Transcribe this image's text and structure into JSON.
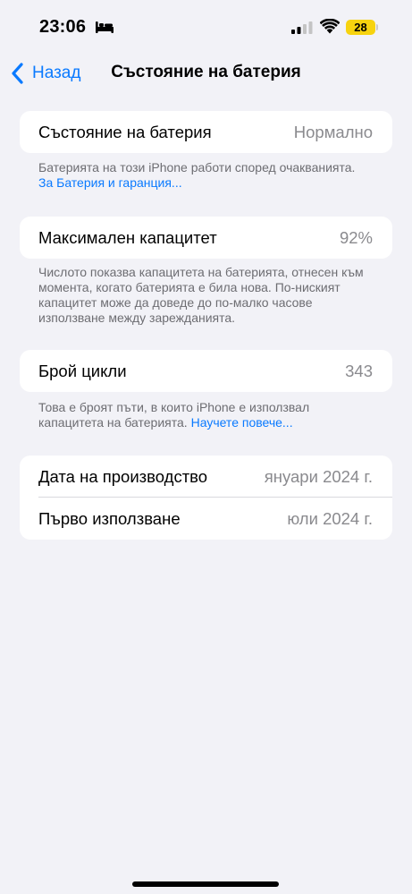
{
  "status_bar": {
    "time": "23:06",
    "battery_level": "28",
    "icons": {
      "focus": "bed-icon",
      "signal": "cellular-signal-icon",
      "wifi": "wifi-icon"
    },
    "battery_color": "#f7d30f"
  },
  "nav": {
    "back_label": "Назад",
    "title": "Състояние на батерия",
    "accent_color": "#0a7aff"
  },
  "sections": {
    "battery_health": {
      "label": "Състояние на батерия",
      "value": "Нормално",
      "note_text": "Батерията на този iPhone работи според очакванията.",
      "note_link": "За Батерия и гаранция..."
    },
    "max_capacity": {
      "label": "Максимален капацитет",
      "value": "92%",
      "note_text": "Числото показва капацитета на батерията, отнесен към момента, когато батерията е била нова. По-ниският капацитет може да доведе до по-малко часове използване между зарежданията."
    },
    "cycle_count": {
      "label": "Брой цикли",
      "value": "343",
      "note_text": "Това е броят пъти, в които iPhone е използвал капацитета на батерията.",
      "note_link": "Научете повече..."
    },
    "dates": {
      "manufacture_label": "Дата на производство",
      "manufacture_value": "януари 2024 г.",
      "first_use_label": "Първо използване",
      "first_use_value": "юли 2024 г."
    }
  }
}
